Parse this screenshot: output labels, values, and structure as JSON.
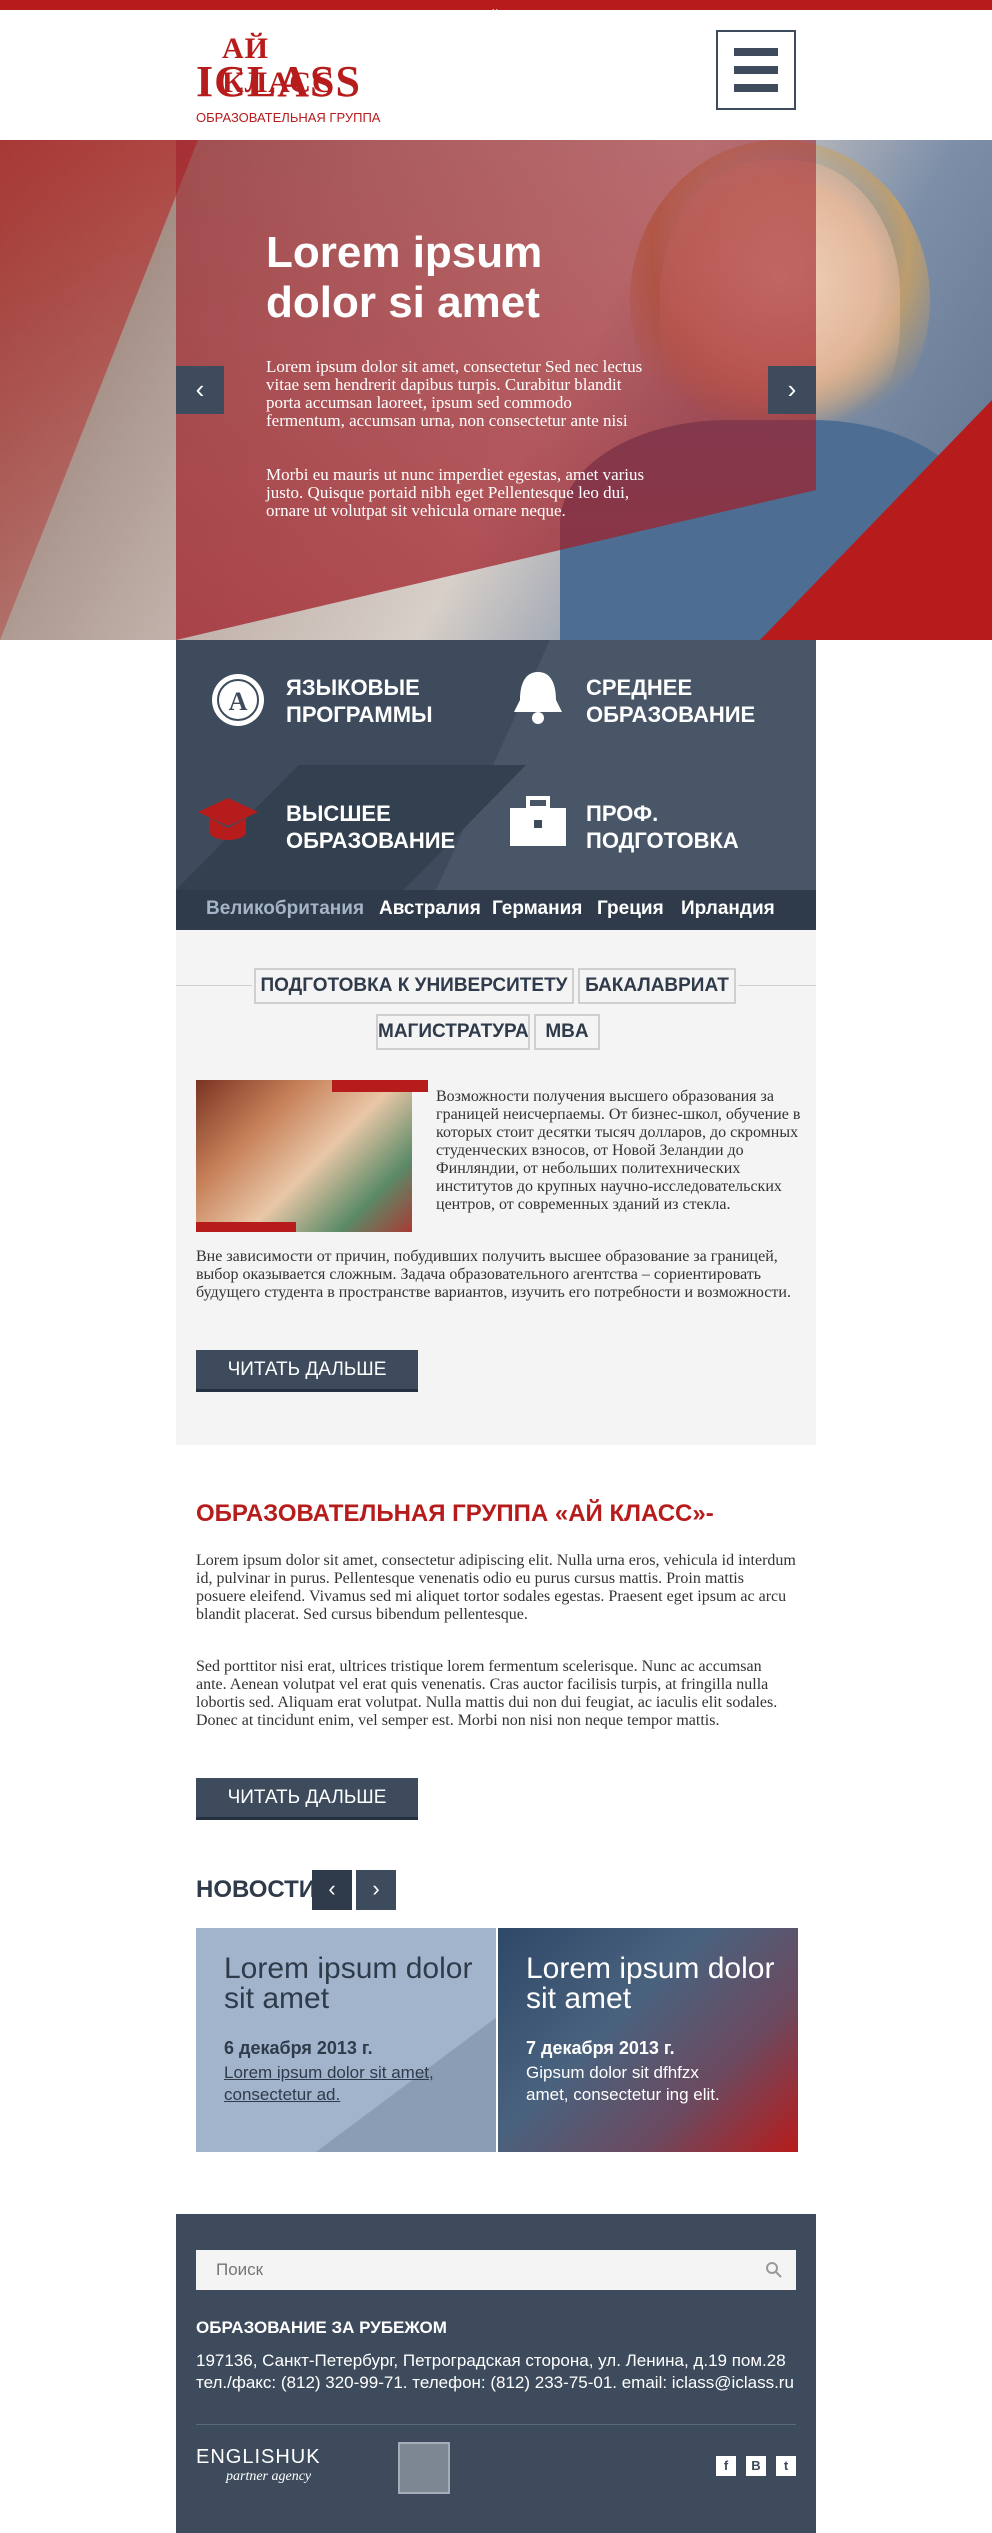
{
  "logo": {
    "line1": "АЙ КЛАСС",
    "line2": "ICLASS",
    "line3": "ОБРАЗОВАТЕЛЬНАЯ ГРУППА"
  },
  "hero": {
    "title_line1": "Lorem ipsum",
    "title_line2": "dolor si amet",
    "p1": "Lorem ipsum dolor sit amet, consectetur Sed nec lectus vitae sem hendrerit dapibus turpis. Curabitur blandit porta accumsan laoreet, ipsum sed commodo fermentum, accumsan urna, non consectetur ante nisi",
    "p2": "Morbi eu mauris ut nunc imperdiet egestas, amet varius justo. Quisque portaid nibh eget Pellentesque leo dui, ornare ut volutpat sit vehicula ornare neque.",
    "prev": "‹",
    "next": "›"
  },
  "programs": [
    {
      "line1": "ЯЗЫКОВЫЕ",
      "line2": "ПРОГРАММЫ",
      "icon": "globe-icon"
    },
    {
      "line1": "СРЕДНЕЕ",
      "line2": "ОБРАЗОВАНИЕ",
      "icon": "bell-icon"
    },
    {
      "line1": "ВЫСШЕЕ",
      "line2": "ОБРАЗОВАНИЕ",
      "icon": "graduation-cap-icon"
    },
    {
      "line1": "ПРОФ.",
      "line2": "ПОДГОТОВКА",
      "icon": "briefcase-icon"
    }
  ],
  "countries": [
    "Великобритания",
    "Австралия",
    "Германия",
    "Греция",
    "Ирландия"
  ],
  "tags": [
    "ПОДГОТОВКА К УНИВЕРСИТЕТУ",
    "БАКАЛАВРИАТ",
    "МАГИСТРАТУРА",
    "MBA"
  ],
  "article": {
    "right_text": "Возможности получения высшего образова­ния за границей неисчерпаемы. От биз­нес-школ, обучение в которых стоит десятки тысяч долларов, до скромных студенческих взносов, от Новой Зеландии до Финляндии, от небольших политехнических институтов до крупных научно-исследовательских цен­тров, от современных зданий из стекла.",
    "full_text": "Вне зависимости от причин, побудивших получить высшее образование за границей, выбор оказывается сложным. Задача образовательного агентства – сориентировать будущего студента в пространстве вариантов, изучить его потребности и возможности.",
    "read_more": "ЧИТАТЬ ДАЛЬШЕ"
  },
  "group": {
    "title": "ОБРАЗОВАТЕЛЬНАЯ ГРУППА «АЙ КЛАСС»-",
    "p1": "Lorem ipsum dolor sit amet, consectetur adipiscing elit. Nulla urna eros, vehic­ula id interdum id, pulvinar in purus. Pellentesque venenatis odio eu purus cursus mattis. Proin mattis posuere eleifend. Vivamus sed mi aliquet tortor sodales egestas. Praesent eget ipsum ac arcu blandit placerat. Sed cursus bibendum pellentesque.",
    "p2": "Sed porttitor nisi erat, ultrices tristique lorem fermentum scelerisque. Nunc ac accumsan ante. Aenean volutpat vel erat quis venenatis. Cras auctor facilisis turpis, at fringilla nulla lobortis sed. Aliquam erat volutpat. Nulla mattis dui non dui feugiat, ac iaculis elit sodales. Donec at tincidunt enim, vel semper est. Morbi non nisi non neque tempor mattis.",
    "read_more": "ЧИТАТЬ ДАЛЬШЕ"
  },
  "news": {
    "title": "НОВОСТИ",
    "prev": "‹",
    "next": "›",
    "items": [
      {
        "title": "Lorem ipsum dolor sit amet",
        "date": "6 декабря 2013 г.",
        "text": "Lorem ipsum dolor sit amet, consectetur ad."
      },
      {
        "title": "Lorem ipsum dolor sit amet",
        "date": "7 декабря 2013 г.",
        "text": "Gipsum dolor sit dfhfzx amet, consectetur ing elit."
      }
    ]
  },
  "footer": {
    "search_placeholder": "Поиск",
    "title": "ОБРАЗОВАНИЕ ЗА РУБЕЖОМ",
    "address_line1": "197136, Санкт-Петербург, Петроградская сторона, ул. Ленина, д.19 пом.28",
    "address_line2": "тел./факс: (812) 320-99-71. телефон: (812) 233-75-01. email: iclass@iclass.ru",
    "english_uk": "ENGLISHUK",
    "partner": "partner agency",
    "social": [
      "f",
      "B",
      "t"
    ]
  },
  "colors": {
    "accent": "#b71c1c",
    "dark": "#3d4b5c",
    "panel": "#f4f4f4"
  }
}
